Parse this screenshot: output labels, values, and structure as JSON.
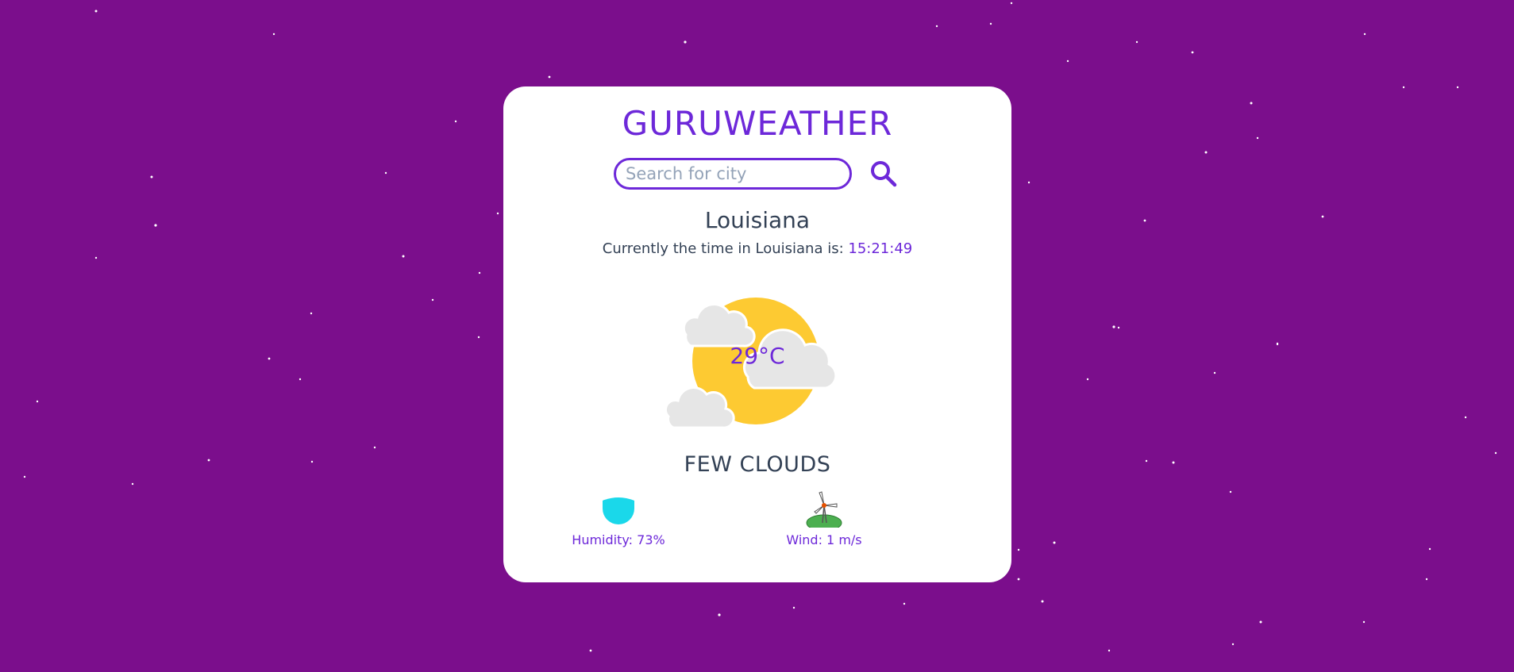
{
  "app": {
    "title": "GURUWEATHER"
  },
  "search": {
    "placeholder": "Search for city",
    "value": "",
    "button_icon": "search-icon"
  },
  "location": {
    "city": "Louisiana",
    "time_prefix": "Currently the time in Louisiana is: ",
    "time": "15:21:49"
  },
  "weather": {
    "icon": "partly-cloudy-icon",
    "temperature": "29°C",
    "description": "FEW CLOUDS"
  },
  "stats": {
    "humidity": {
      "icon": "humidity-drop-icon",
      "label": "Humidity: 73%"
    },
    "wind": {
      "icon": "wind-turbine-icon",
      "label": "Wind: 1 m/s"
    }
  },
  "colors": {
    "background": "#7b0e8c",
    "accent": "#6d28d9",
    "text": "#334155",
    "sun": "#fdca32",
    "cloud": "#e6e6e6",
    "humidity": "#1ad8ea"
  }
}
